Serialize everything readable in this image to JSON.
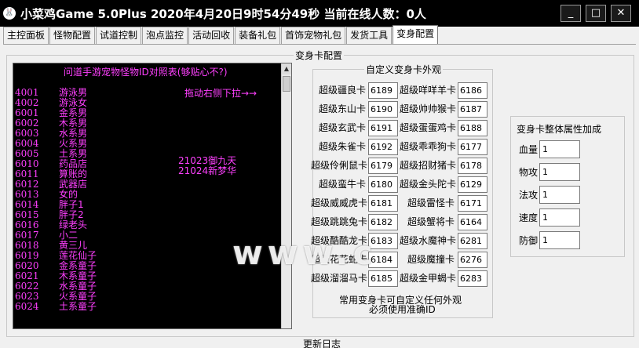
{
  "window": {
    "title": "小菜鸡Game 5.0Plus  2020年4月20日9时54分49秒  当前在线人数：0人",
    "app_icon": "rabbit-icon",
    "minimize_glyph": "_",
    "maximize_glyph": "□",
    "close_glyph": "✕"
  },
  "tabs": [
    {
      "label": "主控面板"
    },
    {
      "label": "怪物配置"
    },
    {
      "label": "试道控制"
    },
    {
      "label": "泡点监控"
    },
    {
      "label": "活动回收"
    },
    {
      "label": "装备礼包"
    },
    {
      "label": "首饰宠物礼包"
    },
    {
      "label": "发货工具"
    },
    {
      "label": "变身配置",
      "active": true
    }
  ],
  "main": {
    "group_title": "变身卡配置",
    "update_log_label": "更新日志"
  },
  "id_table": {
    "header": "问道手游宠物怪物ID对照表(够贴心不?)",
    "hint": "拖动右侧下拉→→",
    "extra": [
      "21023御九天",
      "21024新梦华"
    ],
    "rows": [
      {
        "code": "4001",
        "name": "游泳男"
      },
      {
        "code": "4002",
        "name": "游泳女"
      },
      {
        "code": "6001",
        "name": "金系男"
      },
      {
        "code": "6002",
        "name": "木系男"
      },
      {
        "code": "6003",
        "name": "水系男"
      },
      {
        "code": "6004",
        "name": "火系男"
      },
      {
        "code": "6005",
        "name": "土系男"
      },
      {
        "code": "6010",
        "name": "药品店"
      },
      {
        "code": "6011",
        "name": "算账的"
      },
      {
        "code": "6012",
        "name": "武器店"
      },
      {
        "code": "6013",
        "name": "女的"
      },
      {
        "code": "6014",
        "name": "胖子1"
      },
      {
        "code": "6015",
        "name": "胖子2"
      },
      {
        "code": "6016",
        "name": "绿老头"
      },
      {
        "code": "6017",
        "name": "小二"
      },
      {
        "code": "6018",
        "name": "黄三儿"
      },
      {
        "code": "6019",
        "name": "莲花仙子"
      },
      {
        "code": "6020",
        "name": "金系童子"
      },
      {
        "code": "6021",
        "name": "木系童子"
      },
      {
        "code": "6022",
        "name": "水系童子"
      },
      {
        "code": "6023",
        "name": "火系童子"
      },
      {
        "code": "6024",
        "name": "土系童子"
      }
    ]
  },
  "custom_cards": {
    "title": "自定义变身卡外观",
    "left": [
      {
        "label": "超级疆良卡",
        "value": "6189"
      },
      {
        "label": "超级东山卡",
        "value": "6190"
      },
      {
        "label": "超级玄武卡",
        "value": "6191"
      },
      {
        "label": "超级朱雀卡",
        "value": "6192"
      },
      {
        "label": "超级伶俐鼠卡",
        "value": "6179"
      },
      {
        "label": "超级蛮牛卡",
        "value": "6180"
      },
      {
        "label": "超级威威虎卡",
        "value": "6181"
      },
      {
        "label": "超级跳跳兔卡",
        "value": "6182"
      },
      {
        "label": "超级酷酷龙卡",
        "value": "6183"
      },
      {
        "label": "超级花花蛇卡",
        "value": "6184"
      },
      {
        "label": "超级溜溜马卡",
        "value": "6185"
      }
    ],
    "right": [
      {
        "label": "超级咩咩羊卡",
        "value": "6186"
      },
      {
        "label": "超级帅帅猴卡",
        "value": "6187"
      },
      {
        "label": "超级蛋蛋鸡卡",
        "value": "6188"
      },
      {
        "label": "超级乖乖狗卡",
        "value": "6177"
      },
      {
        "label": "超级招财猪卡",
        "value": "6178"
      },
      {
        "label": "超级金头陀卡",
        "value": "6129"
      },
      {
        "label": "超级雷怪卡",
        "value": "6171"
      },
      {
        "label": "超级蟹将卡",
        "value": "6164"
      },
      {
        "label": "超级水魔神卡",
        "value": "6281"
      },
      {
        "label": "超级魔撞卡",
        "value": "6276"
      },
      {
        "label": "超级金甲蝎卡",
        "value": "6283"
      }
    ],
    "note_line1": "常用变身卡可自定义任何外观",
    "note_line2": "必须使用准确ID"
  },
  "properties": {
    "title": "变身卡整体属性加成",
    "items": [
      {
        "label": "血量",
        "value": "1"
      },
      {
        "label": "物攻",
        "value": "1"
      },
      {
        "label": "法攻",
        "value": "1"
      },
      {
        "label": "速度",
        "value": "1"
      },
      {
        "label": "防御",
        "value": "1"
      }
    ]
  },
  "watermark": "www.c"
}
